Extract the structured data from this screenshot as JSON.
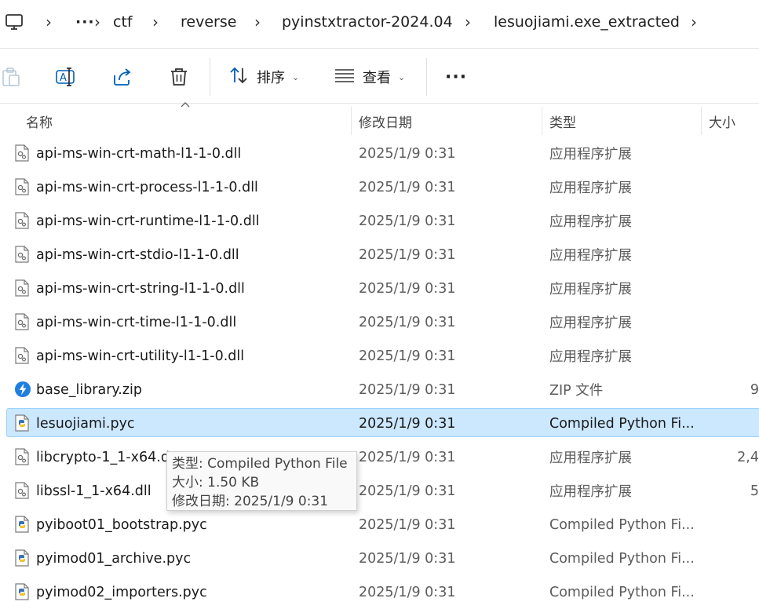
{
  "breadcrumb": {
    "more": "···",
    "items": [
      "ctf",
      "reverse",
      "pyinstxtractor-2024.04",
      "lesuojiami.exe_extracted"
    ]
  },
  "toolbar": {
    "sort_label": "排序",
    "view_label": "查看",
    "more_label": "···"
  },
  "columns": {
    "name": "名称",
    "date": "修改日期",
    "type": "类型",
    "size": "大小"
  },
  "files": [
    {
      "name": "api-ms-win-crt-math-l1-1-0.dll",
      "date": "2025/1/9 0:31",
      "type": "应用程序扩展",
      "size": "",
      "icon": "dll-file-icon"
    },
    {
      "name": "api-ms-win-crt-process-l1-1-0.dll",
      "date": "2025/1/9 0:31",
      "type": "应用程序扩展",
      "size": "",
      "icon": "dll-file-icon"
    },
    {
      "name": "api-ms-win-crt-runtime-l1-1-0.dll",
      "date": "2025/1/9 0:31",
      "type": "应用程序扩展",
      "size": "",
      "icon": "dll-file-icon"
    },
    {
      "name": "api-ms-win-crt-stdio-l1-1-0.dll",
      "date": "2025/1/9 0:31",
      "type": "应用程序扩展",
      "size": "",
      "icon": "dll-file-icon"
    },
    {
      "name": "api-ms-win-crt-string-l1-1-0.dll",
      "date": "2025/1/9 0:31",
      "type": "应用程序扩展",
      "size": "",
      "icon": "dll-file-icon"
    },
    {
      "name": "api-ms-win-crt-time-l1-1-0.dll",
      "date": "2025/1/9 0:31",
      "type": "应用程序扩展",
      "size": "",
      "icon": "dll-file-icon"
    },
    {
      "name": "api-ms-win-crt-utility-l1-1-0.dll",
      "date": "2025/1/9 0:31",
      "type": "应用程序扩展",
      "size": "",
      "icon": "dll-file-icon"
    },
    {
      "name": "base_library.zip",
      "date": "2025/1/9 0:31",
      "type": "ZIP 文件",
      "size": "9",
      "icon": "zip-file-icon"
    },
    {
      "name": "lesuojiami.pyc",
      "date": "2025/1/9 0:31",
      "type": "Compiled Python Fi...",
      "size": "",
      "icon": "python-file-icon",
      "selected": true
    },
    {
      "name": "libcrypto-1_1-x64.d",
      "date": "2025/1/9 0:31",
      "type": "应用程序扩展",
      "size": "2,4",
      "icon": "dll-file-icon"
    },
    {
      "name": "libssl-1_1-x64.dll",
      "date": "2025/1/9 0:31",
      "type": "应用程序扩展",
      "size": "5",
      "icon": "dll-file-icon"
    },
    {
      "name": "pyiboot01_bootstrap.pyc",
      "date": "2025/1/9 0:31",
      "type": "Compiled Python Fi...",
      "size": "",
      "icon": "python-file-icon"
    },
    {
      "name": "pyimod01_archive.pyc",
      "date": "2025/1/9 0:31",
      "type": "Compiled Python Fi...",
      "size": "",
      "icon": "python-file-icon"
    },
    {
      "name": "pyimod02_importers.pyc",
      "date": "2025/1/9 0:31",
      "type": "Compiled Python Fi...",
      "size": "",
      "icon": "python-file-icon"
    }
  ],
  "tooltip": {
    "line1": "类型: Compiled Python File",
    "line2": "大小: 1.50 KB",
    "line3": "修改日期: 2025/1/9 0:31"
  },
  "colors": {
    "selection": "#cce8ff",
    "selection_border": "#99d1ff",
    "accent": "#005fb8"
  }
}
